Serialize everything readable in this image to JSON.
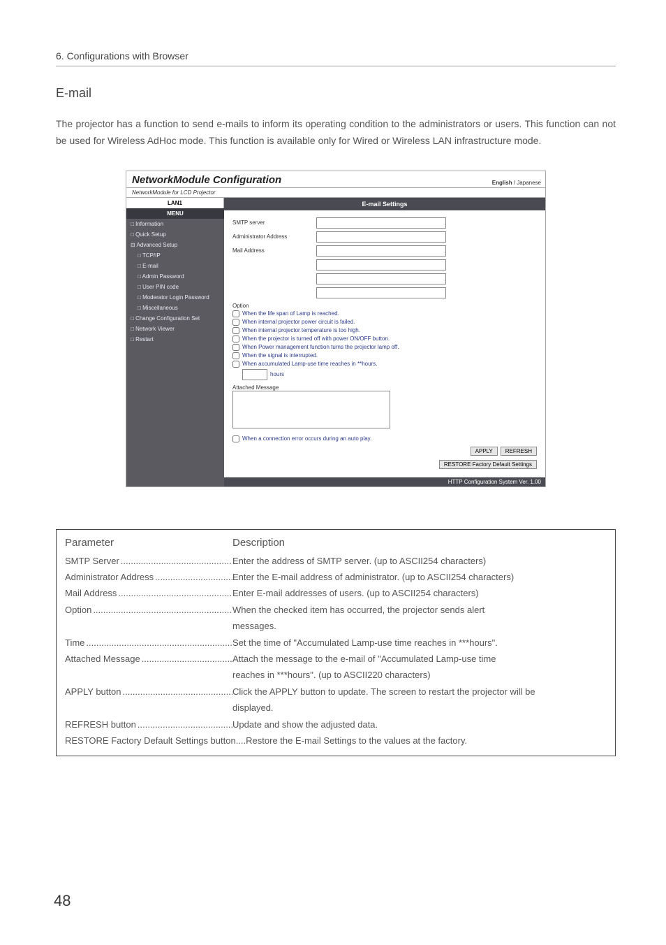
{
  "header": {
    "breadcrumb": "6. Configurations with Browser"
  },
  "section": {
    "title": "E-mail",
    "intro": "The projector has a function to send e-mails to inform its operating condition to the administrators or users.  This function can not be used for Wireless AdHoc mode.  This function is available only for Wired or Wireless LAN infrastructure mode."
  },
  "screenshot": {
    "title": "NetworkModule Configuration",
    "subtitle": "NetworkModule for LCD Projector",
    "lang_english": "English",
    "lang_japanese": "Japanese",
    "sidebar_tab": "LAN1",
    "menu_label": "MENU",
    "nav": {
      "information": "Information",
      "quick_setup": "Quick Setup",
      "advanced_setup": "Advanced Setup",
      "tcpip": "TCP/IP",
      "email": "E-mail",
      "admin_password": "Admin Password",
      "user_pin_code": "User PIN code",
      "moderator_login_password": "Moderator Login Password",
      "miscellaneous": "Miscellaneous",
      "change_config_set": "Change Configuration Set",
      "network_viewer": "Network Viewer",
      "restart": "Restart"
    },
    "panel": {
      "heading": "E-mail Settings",
      "smtp_server": "SMTP server",
      "admin_address": "Administrator Address",
      "mail_address": "Mail Address",
      "option_label": "Option",
      "opt1": "When the life span of Lamp is reached.",
      "opt2": "When internal projector power circuit is failed.",
      "opt3": "When internal projector temperature is too high.",
      "opt4": "When the projector is turned off with power ON/OFF button.",
      "opt5": "When Power management function turns the projector lamp off.",
      "opt6": "When the signal is interrupted.",
      "opt7": "When accumulated Lamp-use time reaches in **hours.",
      "hours_label": "hours",
      "msg_label": "Attached Message",
      "opt_err": "When a connection error occurs during an auto play.",
      "btn_apply": "APPLY",
      "btn_refresh": "REFRESH",
      "btn_restore": "RESTORE Factory Default Settings",
      "footer": "HTTP Configuration System Ver. 1.00"
    }
  },
  "table": {
    "head_param": "Parameter",
    "head_desc": "Description",
    "rows": {
      "smtp_p": "SMTP Server ",
      "smtp_d": "Enter the address of SMTP server.  (up to ASCII254 characters)",
      "admin_p": "Administrator Address ",
      "admin_d": "Enter the E-mail address of administrator.  (up to ASCII254 characters)",
      "mail_p": "Mail Address ",
      "mail_d": "Enter E-mail addresses of users.  (up to ASCII254 characters)",
      "option_p": "Option",
      "option_d": "When the checked item has occurred, the projector sends alert",
      "option_d2": "messages.",
      "time_p": "Time ",
      "time_d": "Set the time of \"Accumulated Lamp-use time reaches in ***hours\".",
      "attach_p": "Attached Message ",
      "attach_d": "Attach the message to the e-mail of \"Accumulated Lamp-use time",
      "attach_d2": "reaches in ***hours\". (up to ASCII220 characters)",
      "apply_p": "APPLY button ",
      "apply_d": "Click the APPLY button to update. The screen to restart the projector will be",
      "apply_d2": "displayed.",
      "refresh_p": "REFRESH button ",
      "refresh_d": "Update and show the adjusted data.",
      "restore_full": "RESTORE Factory Default Settings button....Restore the E-mail Settings to the values at the factory."
    }
  },
  "page_number": "48"
}
